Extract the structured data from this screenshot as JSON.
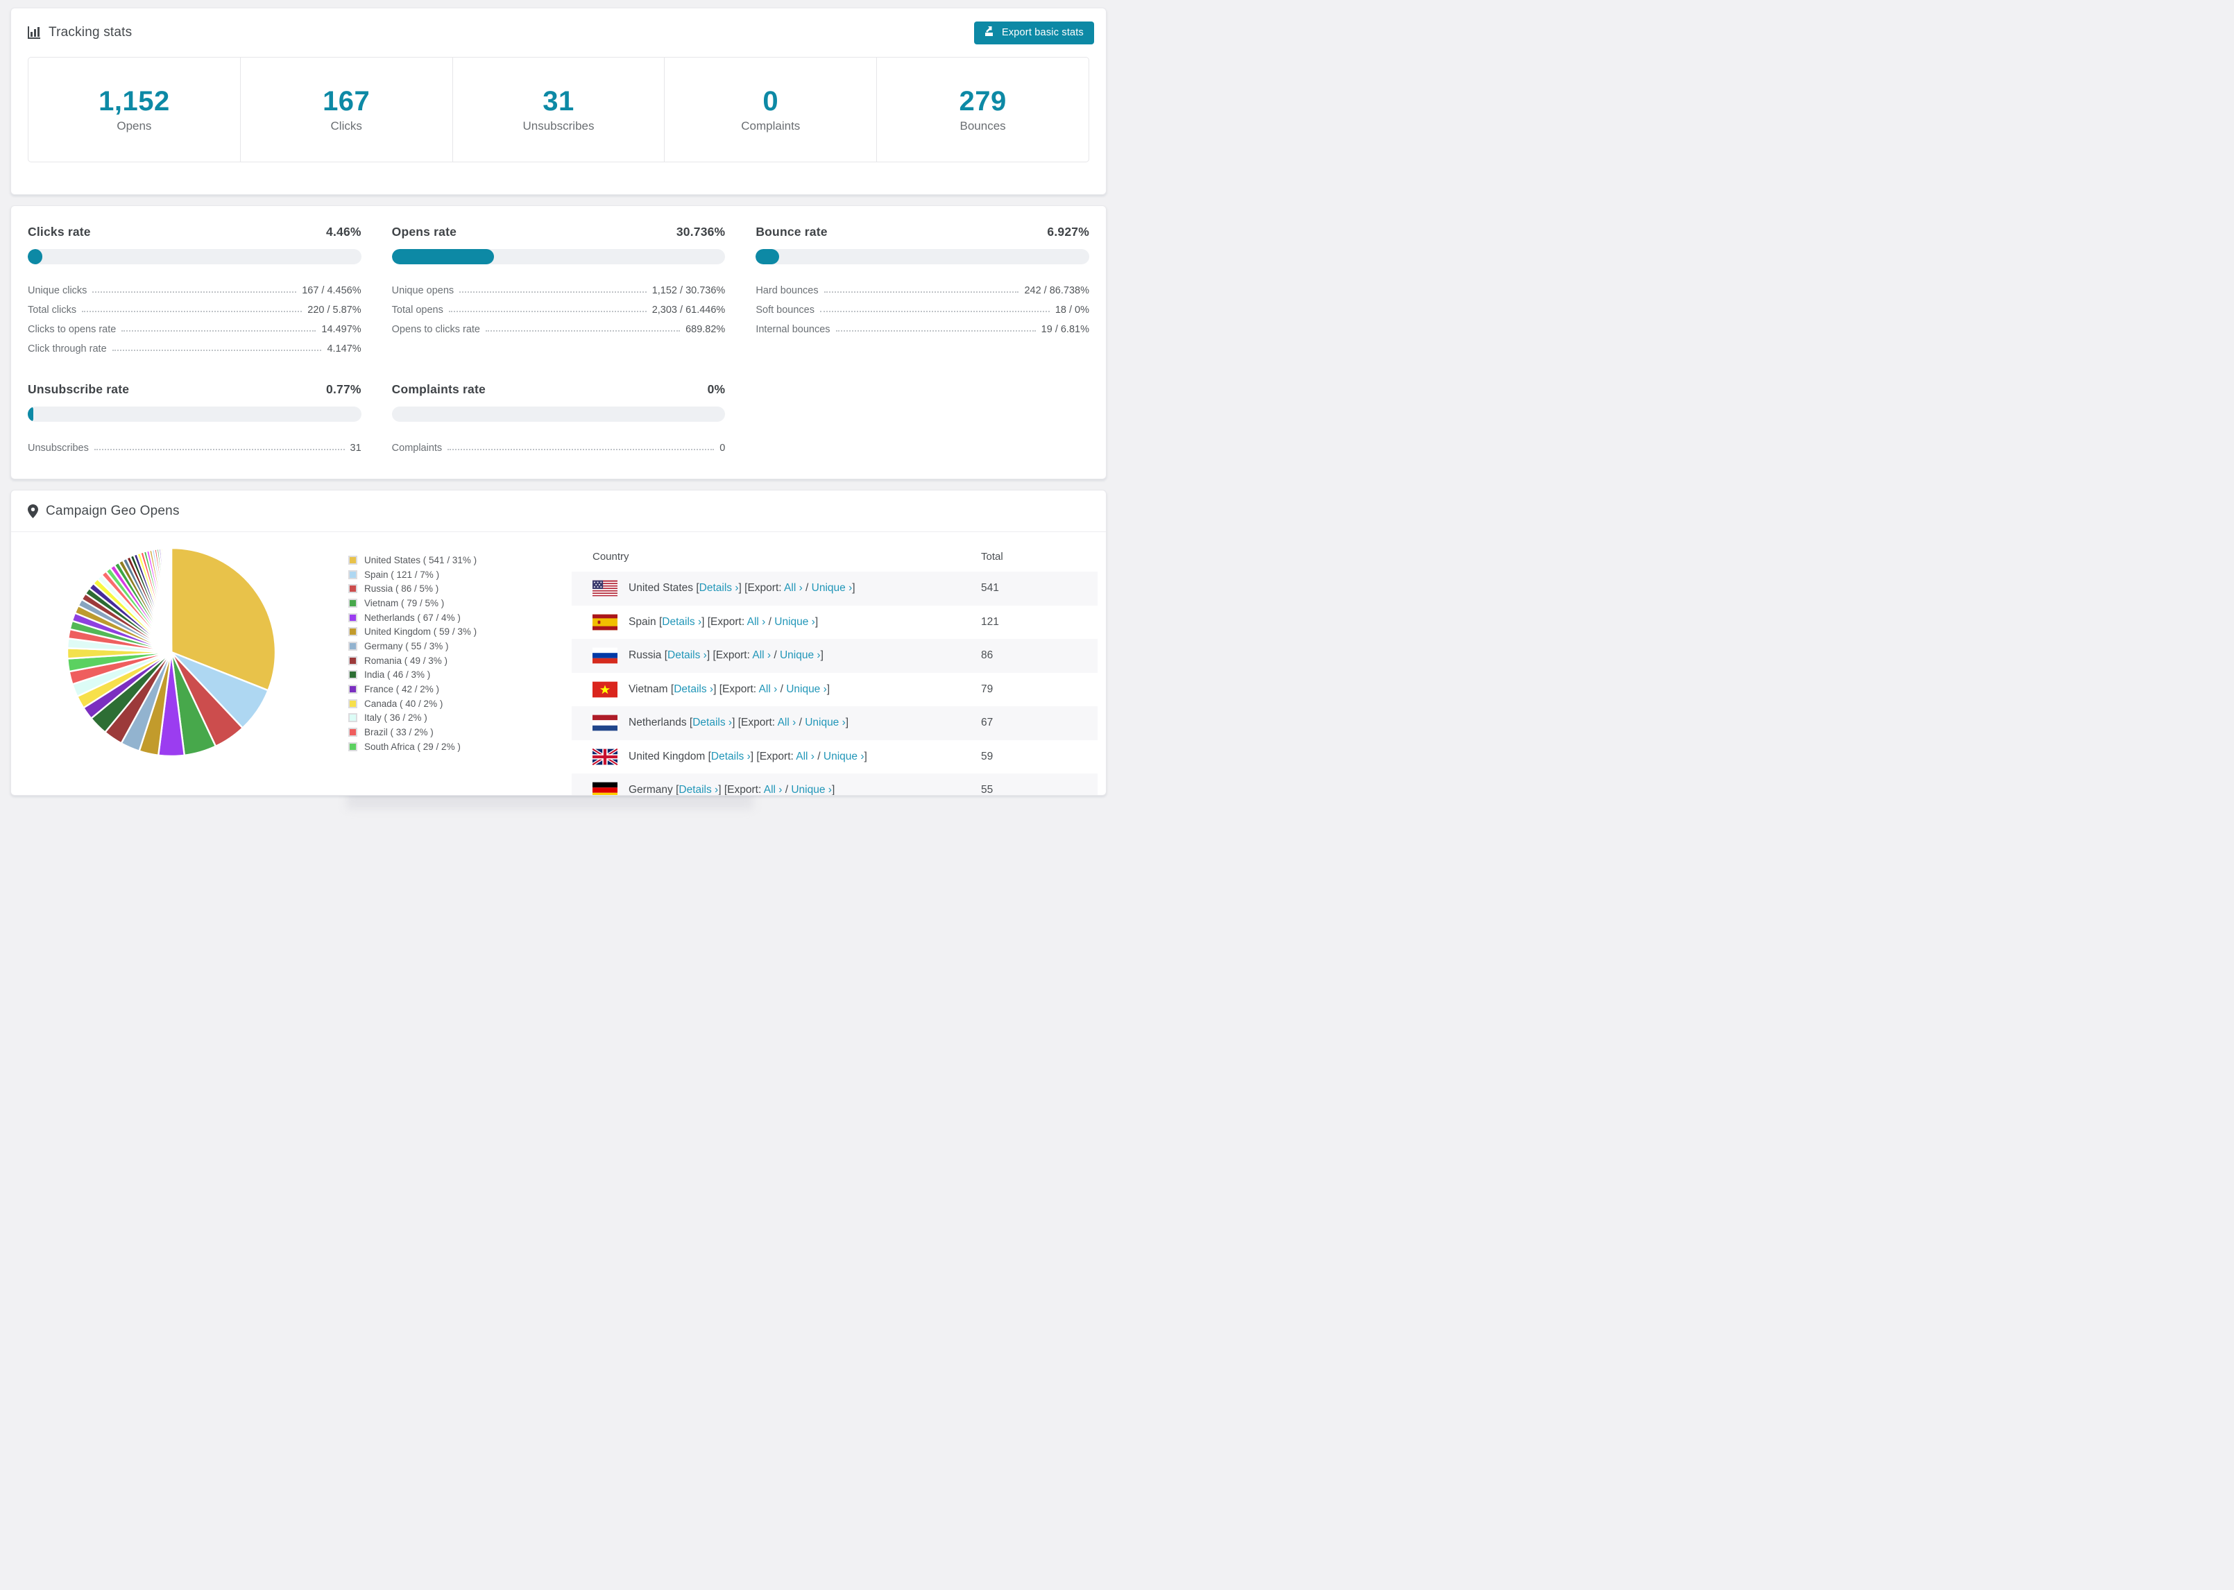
{
  "accent": {
    "teal": "#0d89a5",
    "link": "#2196b8"
  },
  "tracking": {
    "title": "Tracking stats",
    "export_button": "Export basic stats",
    "stats": [
      {
        "value": "1,152",
        "label": "Opens"
      },
      {
        "value": "167",
        "label": "Clicks"
      },
      {
        "value": "31",
        "label": "Unsubscribes"
      },
      {
        "value": "0",
        "label": "Complaints"
      },
      {
        "value": "279",
        "label": "Bounces"
      }
    ]
  },
  "rates": {
    "sections": [
      {
        "title": "Clicks rate",
        "value": "4.46%",
        "pct": 4.46,
        "rows": [
          {
            "label": "Unique clicks",
            "value": "167 / 4.456%"
          },
          {
            "label": "Total clicks",
            "value": "220 / 5.87%"
          },
          {
            "label": "Clicks to opens rate",
            "value": "14.497%"
          },
          {
            "label": "Click through rate",
            "value": "4.147%"
          }
        ]
      },
      {
        "title": "Opens rate",
        "value": "30.736%",
        "pct": 30.736,
        "rows": [
          {
            "label": "Unique opens",
            "value": "1,152 / 30.736%"
          },
          {
            "label": "Total opens",
            "value": "2,303 / 61.446%"
          },
          {
            "label": "Opens to clicks rate",
            "value": "689.82%"
          }
        ]
      },
      {
        "title": "Bounce rate",
        "value": "6.927%",
        "pct": 6.927,
        "rows": [
          {
            "label": "Hard bounces",
            "value": "242 / 86.738%"
          },
          {
            "label": "Soft bounces",
            "value": "18 / 0%"
          },
          {
            "label": "Internal bounces",
            "value": "19 / 6.81%"
          }
        ]
      },
      {
        "title": "Unsubscribe rate",
        "value": "0.77%",
        "pct": 0.77,
        "rows": [
          {
            "label": "Unsubscribes",
            "value": "31"
          }
        ]
      },
      {
        "title": "Complaints rate",
        "value": "0%",
        "pct": 0,
        "rows": [
          {
            "label": "Complaints",
            "value": "0"
          }
        ]
      }
    ]
  },
  "chart_data": {
    "type": "pie",
    "title": "Campaign Geo Opens",
    "unit": "opens",
    "legend_position": "right",
    "labels": [
      "United States",
      "Spain",
      "Russia",
      "Vietnam",
      "Netherlands",
      "United Kingdom",
      "Germany",
      "Romania",
      "India",
      "France",
      "Canada",
      "Italy",
      "Brazil",
      "South Africa"
    ],
    "values": [
      541,
      121,
      86,
      79,
      67,
      59,
      55,
      49,
      46,
      42,
      40,
      36,
      33,
      29
    ],
    "percents": [
      31,
      7,
      5,
      5,
      4,
      3,
      3,
      3,
      3,
      2,
      2,
      2,
      2,
      2
    ],
    "colors": [
      "#e8c24a",
      "#aed7f2",
      "#cc4d4d",
      "#47a84b",
      "#9b3df0",
      "#c29b2c",
      "#92b3cf",
      "#9c3a3a",
      "#2d6e34",
      "#7b2fc0",
      "#f7e04b",
      "#dcfcf6",
      "#ef5e5e",
      "#5bd160"
    ],
    "others": {
      "note": "unlabeled small slices totaling ~26% of opens",
      "percents": [
        1.45,
        1.35,
        1.3,
        1.2,
        1.15,
        1.1,
        1.0,
        0.95,
        0.9,
        0.88,
        0.85,
        0.8,
        0.78,
        0.75,
        0.7,
        0.68,
        0.65,
        0.6,
        0.55,
        0.52,
        0.5,
        0.48,
        0.45,
        0.42,
        0.4,
        0.38,
        0.35,
        0.32,
        0.3,
        0.28,
        0.25,
        0.22,
        0.2,
        0.18,
        0.15,
        0.13,
        0.11,
        0.09,
        0.07,
        0.05
      ],
      "total_pct": 26,
      "colors": [
        "#f2e14c",
        "#dffbf6",
        "#ee5f5f",
        "#53b857",
        "#8e3fe0",
        "#bd9b2f",
        "#88a4bf",
        "#9c3a3a",
        "#2c6b33",
        "#472b9a",
        "#f7f73f",
        "#e9fffb",
        "#fa6c6c",
        "#67de6b",
        "#d53ce2",
        "#3da542",
        "#8f7d22",
        "#5c7e98",
        "#7e2222",
        "#1e4f24",
        "#3b2a86",
        "#ffff55",
        "#ff5656",
        "#49bd4e",
        "#e243fb",
        "#d2a537",
        "#a9d5f2",
        "#e53b3b",
        "#44a24a",
        "#7e57c8",
        "#f6e654",
        "#ccf3ef",
        "#f37a70",
        "#5ed463",
        "#c229d6",
        "#2f8757",
        "#bd8a14",
        "#6783a0",
        "#8d2121",
        "#275831"
      ]
    }
  },
  "geo": {
    "title": "Campaign Geo Opens",
    "legend_format": "name ( count / pct% )",
    "table": {
      "headers": [
        "Country",
        "Total"
      ],
      "link_labels": {
        "details": "Details ›",
        "export_prefix": "[Export:",
        "all": "All ›",
        "unique": "Unique ›"
      },
      "rows": [
        {
          "country": "United States",
          "flag": "us",
          "total": "541"
        },
        {
          "country": "Spain",
          "flag": "es",
          "total": "121"
        },
        {
          "country": "Russia",
          "flag": "ru",
          "total": "86"
        },
        {
          "country": "Vietnam",
          "flag": "vn",
          "total": "79"
        },
        {
          "country": "Netherlands",
          "flag": "nl",
          "total": "67"
        },
        {
          "country": "United Kingdom",
          "flag": "gb",
          "total": "59"
        },
        {
          "country": "Germany",
          "flag": "de",
          "total": "55"
        }
      ]
    }
  }
}
